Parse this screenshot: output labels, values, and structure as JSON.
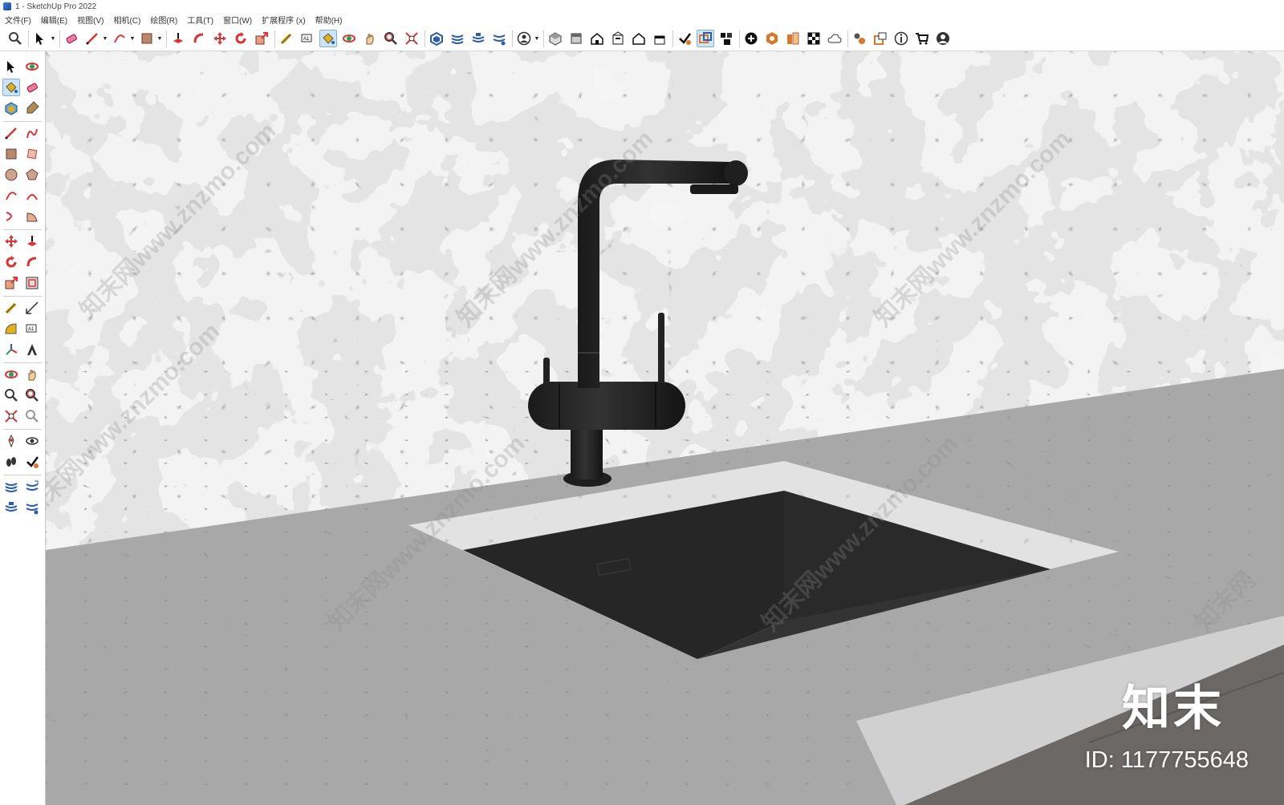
{
  "window": {
    "title": "1 - SketchUp Pro 2022"
  },
  "menu": [
    "文件(F)",
    "编辑(E)",
    "视图(V)",
    "相机(C)",
    "绘图(R)",
    "工具(T)",
    "窗口(W)",
    "扩展程序 (x)",
    "帮助(H)"
  ],
  "toolbar_top": [
    {
      "name": "zoom-icon",
      "active": false
    },
    {
      "name": "select-icon",
      "dropdown": true,
      "active": false
    },
    {
      "name": "eraser-icon",
      "active": false
    },
    {
      "name": "pencil-line-icon",
      "dropdown": true,
      "active": false
    },
    {
      "name": "arc-icon",
      "dropdown": true,
      "active": false
    },
    {
      "name": "rectangle-icon",
      "dropdown": true,
      "active": false
    },
    {
      "name": "push-pull-icon",
      "active": false
    },
    {
      "name": "follow-me-icon",
      "active": false
    },
    {
      "name": "move-icon",
      "active": false
    },
    {
      "name": "rotate-icon",
      "active": false
    },
    {
      "name": "scale-icon",
      "active": false
    },
    {
      "name": "tape-measure-icon",
      "active": false
    },
    {
      "name": "text-icon",
      "active": false
    },
    {
      "name": "paint-bucket-icon",
      "active": true
    },
    {
      "name": "orbit-icon",
      "active": false
    },
    {
      "name": "pan-icon",
      "active": false
    },
    {
      "name": "zoom-window-icon",
      "active": false
    },
    {
      "name": "zoom-extents-icon",
      "active": false
    },
    {
      "name": "warehouse-icon",
      "active": false
    },
    {
      "name": "sandbox-icon",
      "active": false
    },
    {
      "name": "sandbox-stamp-icon",
      "active": false
    },
    {
      "name": "sandbox-flip-icon",
      "active": false
    },
    {
      "name": "user-account-icon",
      "dropdown": true,
      "active": false
    },
    {
      "name": "iso-view-icon",
      "active": false
    },
    {
      "name": "top-view-icon",
      "active": false
    },
    {
      "name": "front-view-icon",
      "active": false
    },
    {
      "name": "right-view-icon",
      "active": false
    },
    {
      "name": "back-view-icon",
      "active": false
    },
    {
      "name": "left-view-icon",
      "active": false
    },
    {
      "name": "section-plane-icon",
      "active": false
    },
    {
      "name": "section-display-icon",
      "active": true
    },
    {
      "name": "section-fill-icon",
      "active": false
    },
    {
      "name": "add-location-icon",
      "active": false
    },
    {
      "name": "geo-icon",
      "active": false
    },
    {
      "name": "photo-texture-icon",
      "active": false
    },
    {
      "name": "checker-icon",
      "active": false
    },
    {
      "name": "cloud-icon",
      "active": false
    },
    {
      "name": "extension-manager-icon",
      "active": false
    },
    {
      "name": "layout-send-icon",
      "active": false
    },
    {
      "name": "info-icon",
      "active": false
    },
    {
      "name": "cart-icon",
      "active": false
    },
    {
      "name": "profile-icon",
      "active": false
    }
  ],
  "toolbar_side": [
    "select-icon",
    "orbit-icon",
    "paint-bucket-icon",
    "eraser-icon",
    "component-icon",
    "tag-icon",
    "pencil-line-icon",
    "freehand-icon",
    "rectangle-icon",
    "rotated-rectangle-icon",
    "circle-icon",
    "polygon-icon",
    "arc-icon",
    "two-point-arc-icon",
    "three-point-arc-icon",
    "pie-icon",
    "move-icon",
    "push-pull-icon",
    "rotate-icon",
    "follow-me-icon",
    "scale-icon",
    "offset-icon",
    "tape-measure-icon",
    "dimension-icon",
    "protractor-icon",
    "text-icon",
    "axes-icon",
    "3d-text-icon",
    "orbit2-icon",
    "pan-icon",
    "zoom-icon",
    "zoom-window-icon",
    "zoom-extents-icon",
    "previous-view-icon",
    "position-camera-icon",
    "look-around-icon",
    "walk-icon",
    "section-plane-icon",
    "sandbox-icon",
    "sandbox-smooth-icon",
    "sandbox-stamp-icon",
    "sandbox-flip-icon"
  ],
  "watermarks": [
    "知末网www.znzmo.com",
    "知末网www.znzmo.com",
    "知末网www.znzmo.com",
    "知末网www.znzmo.com",
    "知末网www.znzmo.com",
    "知末网www.znzmo.com",
    "知末网"
  ],
  "brand": {
    "logo": "知末",
    "id_text": "ID: 1177755648"
  },
  "colors": {
    "active": "#cfe3f7",
    "faucet": "#262626",
    "sink": "#2c2c2c",
    "cabinet": "#6b6865"
  }
}
